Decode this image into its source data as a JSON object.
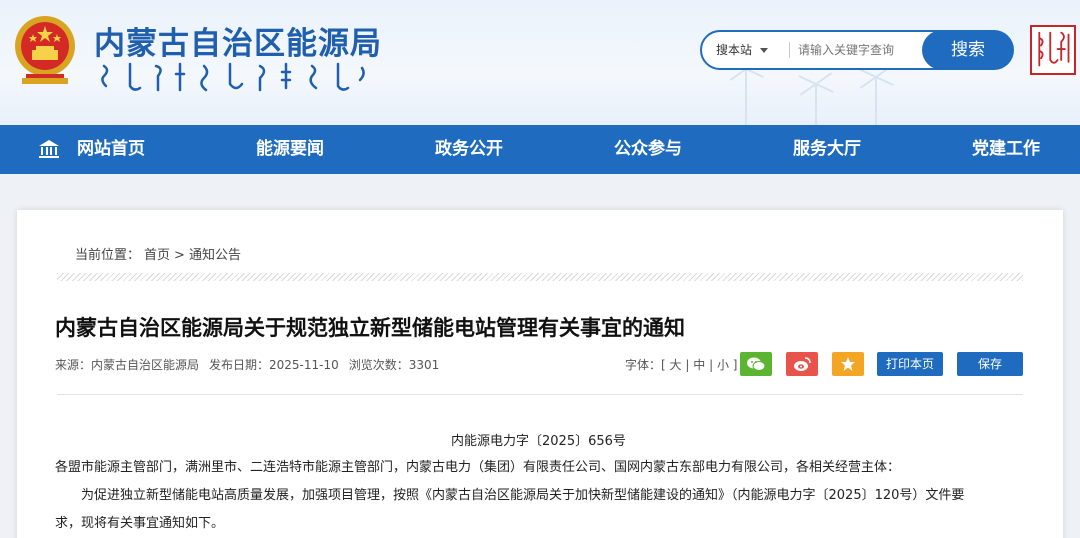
{
  "header": {
    "site_title": "内蒙古自治区能源局",
    "colors": {
      "brand_blue": "#1f6bbf",
      "title_blue": "#1f5fae",
      "seal_red": "#c8252b"
    }
  },
  "search": {
    "scope_label": "搜本站",
    "placeholder": "请输入关键字查询",
    "button_label": "搜索"
  },
  "nav": {
    "items": [
      {
        "label": "网站首页"
      },
      {
        "label": "能源要闻"
      },
      {
        "label": "政务公开"
      },
      {
        "label": "公众参与"
      },
      {
        "label": "服务大厅"
      },
      {
        "label": "党建工作"
      }
    ]
  },
  "breadcrumb": {
    "prefix": "当前位置：",
    "home": "首页",
    "separator": ">",
    "current": "通知公告"
  },
  "article": {
    "title": "内蒙古自治区能源局关于规范独立新型储能电站管理有关事宜的通知",
    "source": "来源：内蒙古自治区能源局",
    "date": "发布日期：2025-11-10",
    "views": "浏览次数：3301",
    "font_label": "字体：[",
    "font_large": "大",
    "font_sep1": "|",
    "font_medium": "中",
    "font_sep2": "|",
    "font_small": "小",
    "font_end": "]",
    "print_label": "打印本页",
    "save_label": "保存",
    "doc_number": "内能源电力字〔2025〕656号",
    "addressee": "各盟市能源主管部门，满洲里市、二连浩特市能源主管部门，内蒙古电力（集团）有限责任公司、国网内蒙古东部电力有限公司，各相关经营主体：",
    "body_line1": "为促进独立新型储能电站高质量发展，加强项目管理，按照《内蒙古自治区能源局关于加快新型储能建设的通知》（内能源电力字〔2025〕120号）文件要",
    "body_line2": "求，现将有关事宜通知如下。"
  },
  "share_icons": [
    "wechat-icon",
    "weibo-icon",
    "favorite-star-icon"
  ]
}
